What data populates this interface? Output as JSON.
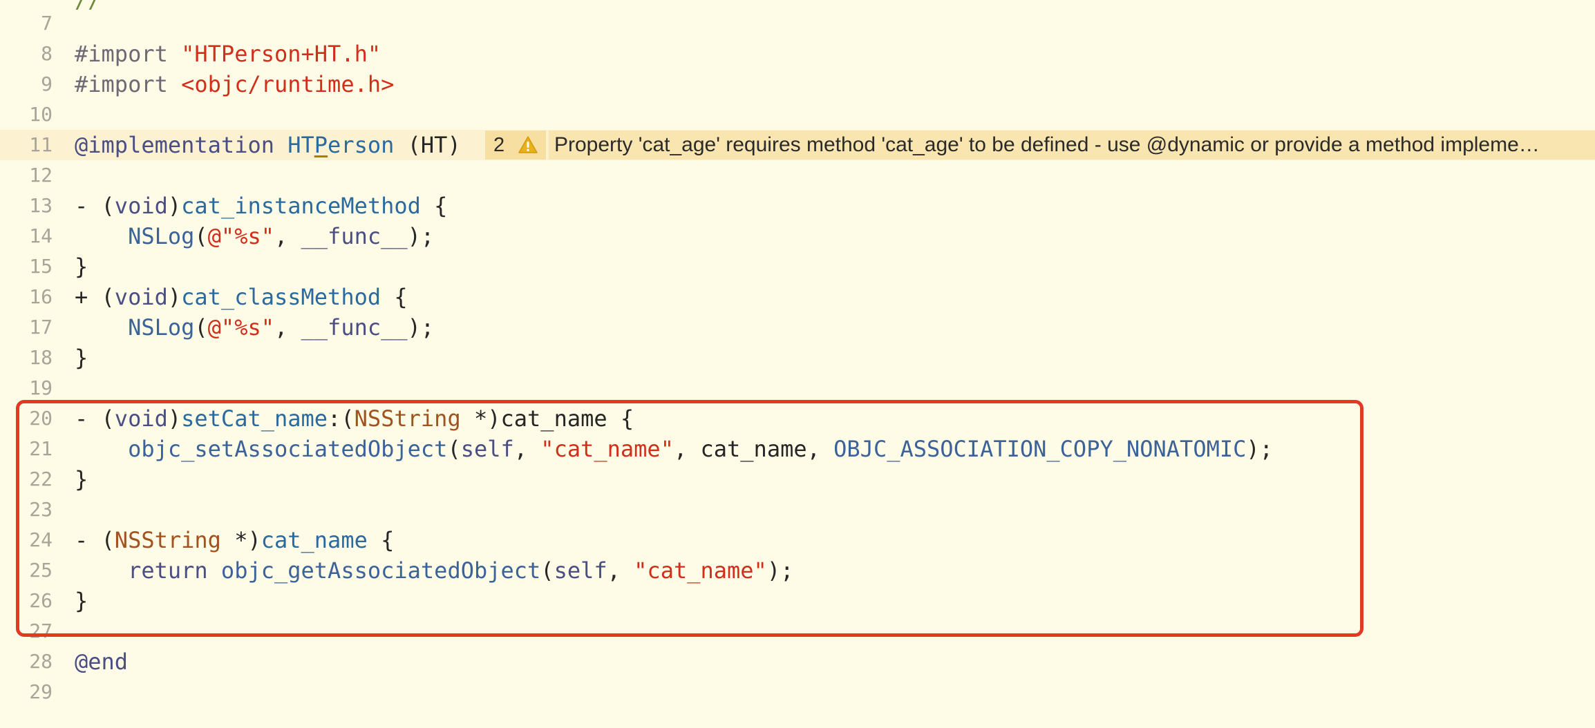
{
  "editor": {
    "first_line_partial": "//",
    "lines": [
      {
        "num": "7",
        "tokens": []
      },
      {
        "num": "8",
        "tokens": [
          {
            "text": "#import ",
            "cls": "t-pp"
          },
          {
            "text": "\"HTPerson+HT.h\"",
            "cls": "t-str"
          }
        ]
      },
      {
        "num": "9",
        "tokens": [
          {
            "text": "#import ",
            "cls": "t-pp"
          },
          {
            "text": "<objc/runtime.h>",
            "cls": "t-str"
          }
        ]
      },
      {
        "num": "10",
        "tokens": []
      },
      {
        "num": "11",
        "highlighted": true,
        "tokens": [
          {
            "text": "@implementation",
            "cls": "t-kw"
          },
          {
            "text": " "
          },
          {
            "text": "HT",
            "cls": "t-cls"
          },
          {
            "text": "P",
            "cls": "t-cls u-char"
          },
          {
            "text": "erson",
            "cls": "t-cls"
          },
          {
            "text": " (HT)"
          }
        ],
        "warning": {
          "count": "2",
          "icon": "warning-triangle-icon",
          "message": "Property 'cat_age' requires method 'cat_age' to be defined - use @dynamic or provide a method impleme…"
        }
      },
      {
        "num": "12",
        "tokens": []
      },
      {
        "num": "13",
        "tokens": [
          {
            "text": "- ("
          },
          {
            "text": "void",
            "cls": "t-kw"
          },
          {
            "text": ")"
          },
          {
            "text": "cat_instanceMethod",
            "cls": "t-cls"
          },
          {
            "text": " {"
          }
        ]
      },
      {
        "num": "14",
        "tokens": [
          {
            "text": "    "
          },
          {
            "text": "NSLog",
            "cls": "t-lib"
          },
          {
            "text": "("
          },
          {
            "text": "@\"%s\"",
            "cls": "t-at"
          },
          {
            "text": ", "
          },
          {
            "text": "__func__",
            "cls": "t-kw"
          },
          {
            "text": ");"
          }
        ]
      },
      {
        "num": "15",
        "tokens": [
          {
            "text": "}"
          }
        ]
      },
      {
        "num": "16",
        "tokens": [
          {
            "text": "+ ("
          },
          {
            "text": "void",
            "cls": "t-kw"
          },
          {
            "text": ")"
          },
          {
            "text": "cat_classMethod",
            "cls": "t-cls"
          },
          {
            "text": " {"
          }
        ]
      },
      {
        "num": "17",
        "tokens": [
          {
            "text": "    "
          },
          {
            "text": "NSLog",
            "cls": "t-lib"
          },
          {
            "text": "("
          },
          {
            "text": "@\"%s\"",
            "cls": "t-at"
          },
          {
            "text": ", "
          },
          {
            "text": "__func__",
            "cls": "t-kw"
          },
          {
            "text": ");"
          }
        ]
      },
      {
        "num": "18",
        "tokens": [
          {
            "text": "}"
          }
        ]
      },
      {
        "num": "19",
        "tokens": []
      },
      {
        "num": "20",
        "tokens": [
          {
            "text": "- ("
          },
          {
            "text": "void",
            "cls": "t-kw"
          },
          {
            "text": ")"
          },
          {
            "text": "setCat_name",
            "cls": "t-cls"
          },
          {
            "text": ":("
          },
          {
            "text": "NSString",
            "cls": "t-type"
          },
          {
            "text": " *)cat_name {"
          }
        ]
      },
      {
        "num": "21",
        "tokens": [
          {
            "text": "    "
          },
          {
            "text": "objc_setAssociatedObject",
            "cls": "t-lib"
          },
          {
            "text": "("
          },
          {
            "text": "self",
            "cls": "t-kw"
          },
          {
            "text": ", "
          },
          {
            "text": "\"cat_name\"",
            "cls": "t-str"
          },
          {
            "text": ", cat_name, "
          },
          {
            "text": "OBJC_ASSOCIATION_COPY_NONATOMIC",
            "cls": "t-lib"
          },
          {
            "text": ");"
          }
        ]
      },
      {
        "num": "22",
        "tokens": [
          {
            "text": "}"
          }
        ]
      },
      {
        "num": "23",
        "tokens": []
      },
      {
        "num": "24",
        "tokens": [
          {
            "text": "- ("
          },
          {
            "text": "NSString",
            "cls": "t-type"
          },
          {
            "text": " *)"
          },
          {
            "text": "cat_name",
            "cls": "t-cls"
          },
          {
            "text": " {"
          }
        ]
      },
      {
        "num": "25",
        "tokens": [
          {
            "text": "    "
          },
          {
            "text": "return",
            "cls": "t-kw"
          },
          {
            "text": " "
          },
          {
            "text": "objc_getAssociatedObject",
            "cls": "t-lib"
          },
          {
            "text": "("
          },
          {
            "text": "self",
            "cls": "t-kw"
          },
          {
            "text": ", "
          },
          {
            "text": "\"cat_name\"",
            "cls": "t-str"
          },
          {
            "text": ");"
          }
        ]
      },
      {
        "num": "26",
        "tokens": [
          {
            "text": "}"
          }
        ]
      },
      {
        "num": "27",
        "tokens": []
      },
      {
        "num": "28",
        "tokens": [
          {
            "text": "@end",
            "cls": "t-kw"
          }
        ]
      },
      {
        "num": "29",
        "tokens": []
      }
    ]
  },
  "colors": {
    "background": "#fefbe6",
    "highlight_line": "#fcf1d1",
    "warning_count_bg": "#f7dea1",
    "warning_message_bg": "#f9e5b0",
    "selection_box": "#e03a25",
    "string": "#d12f1b",
    "keyword": "#4a4e84",
    "identifier": "#2a6a9e",
    "type": "#a0521f"
  }
}
